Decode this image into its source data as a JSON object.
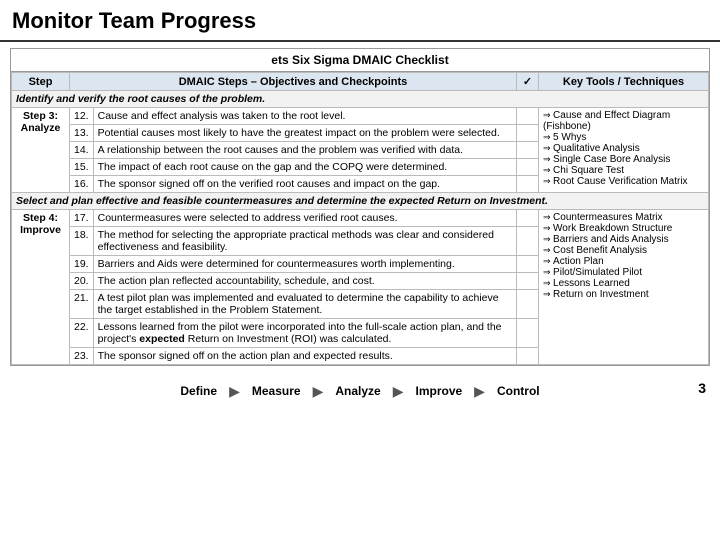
{
  "title": "Monitor Team Progress",
  "checklist_title": "ets Six Sigma DMAIC Checklist",
  "header": {
    "step": "Step",
    "dmaic": "DMAIC Steps – Objectives and Checkpoints",
    "check": "✓",
    "tools": "Key Tools / Techniques"
  },
  "section_analyze": {
    "label": "Identify and verify the root causes of the problem.",
    "step_label": "Step 3:\nAnalyze",
    "rows": [
      {
        "num": "12.",
        "text": "Cause and effect analysis was taken to the root level."
      },
      {
        "num": "13.",
        "text": "Potential causes most likely to have the greatest impact on the problem were selected."
      },
      {
        "num": "14.",
        "text": "A relationship between the root causes and the problem was verified with data."
      },
      {
        "num": "15.",
        "text": "The impact of each root cause on the gap and the COPQ were determined."
      },
      {
        "num": "16.",
        "text": "The sponsor signed off on the verified root causes and impact on the gap."
      }
    ],
    "tools": [
      "Cause and Effect Diagram (Fishbone)",
      "5 Whys",
      "Qualitative Analysis",
      "Single Case Bore Analysis",
      "Chi Square Test",
      "Root Cause Verification Matrix"
    ]
  },
  "section_improve": {
    "label": "Select and plan effective and feasible countermeasures and determine the expected Return on Investment.",
    "step_label": "Step 4:\nImprove",
    "rows": [
      {
        "num": "17.",
        "text": "Countermeasures were selected to address verified root causes."
      },
      {
        "num": "18.",
        "text": "The method for selecting the appropriate practical methods was clear and considered effectiveness and feasibility."
      },
      {
        "num": "19.",
        "text": "Barriers and Aids were determined for countermeasures worth implementing."
      },
      {
        "num": "20.",
        "text": "The action plan reflected accountability, schedule, and cost."
      },
      {
        "num": "21.",
        "text": "A test pilot plan was implemented and evaluated to determine the capability to achieve the target established in the Problem Statement."
      },
      {
        "num": "22.",
        "text": "Lessons learned from the pilot were incorporated into the full-scale action plan, and the project's expected Return on Investment (ROI) was calculated."
      },
      {
        "num": "23.",
        "text": "The sponsor signed off on the action plan and expected results."
      }
    ],
    "tools": [
      "Countermeasures Matrix",
      "Work Breakdown Structure",
      "Barriers and Aids Analysis",
      "Cost Benefit Analysis",
      "Action Plan",
      "Pilot/Simulated Pilot",
      "Lessons Learned",
      "Return on Investment"
    ]
  },
  "nav": {
    "items": [
      "Define",
      "Measure",
      "Analyze",
      "Improve",
      "Control"
    ]
  },
  "page_number": "3"
}
